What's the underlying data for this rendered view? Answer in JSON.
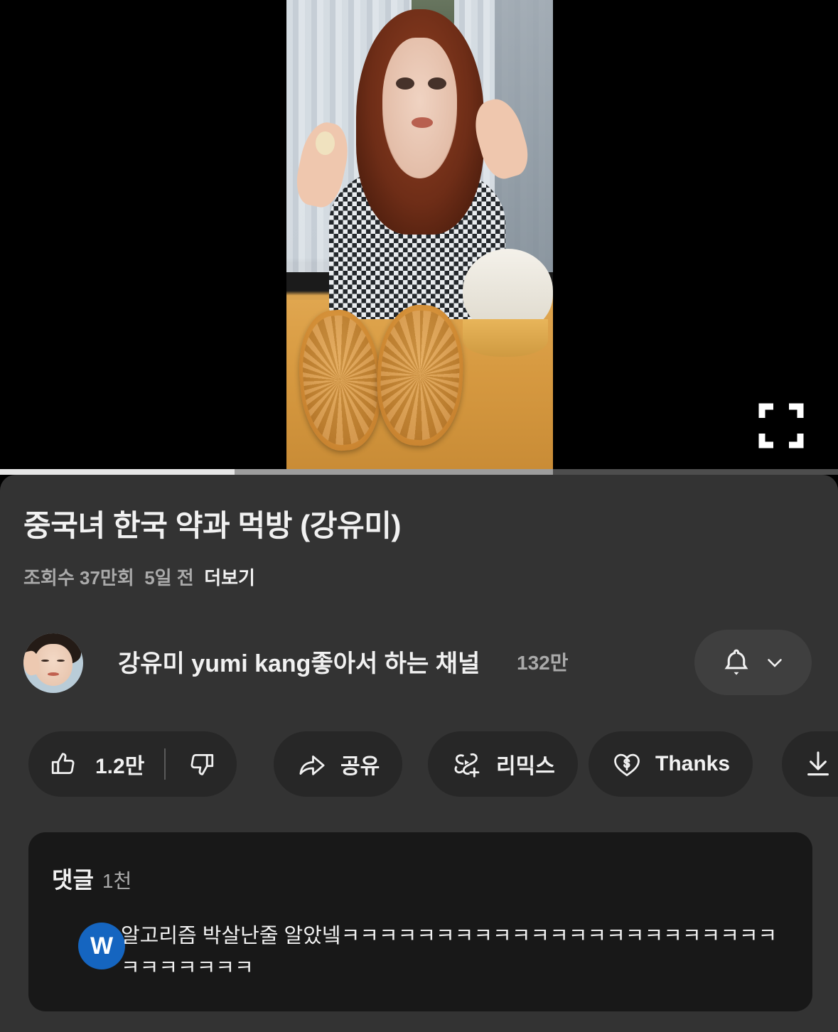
{
  "player": {
    "fullscreen_icon": "fullscreen-icon",
    "progress": {
      "played_percent": 28,
      "buffered_percent": 66
    }
  },
  "video": {
    "title": "중국녀 한국 약과  먹방 (강유미)",
    "views": "조회수 37만회",
    "published": "5일 전",
    "more_label": "더보기"
  },
  "channel": {
    "name": "강유미 yumi kang좋아서 하는 채널",
    "subscribers": "132만",
    "avatar_name": "channel-avatar",
    "bell_icon": "bell-icon",
    "chevron_icon": "chevron-down-icon"
  },
  "actions": {
    "like": {
      "label": "1.2만",
      "icon": "thumbs-up-icon"
    },
    "dislike": {
      "label": "",
      "icon": "thumbs-down-icon"
    },
    "share": {
      "label": "공유",
      "icon": "share-arrow-icon"
    },
    "remix": {
      "label": "리믹스",
      "icon": "remix-icon"
    },
    "thanks": {
      "label": "Thanks",
      "icon": "heart-dollar-icon"
    },
    "download": {
      "label": "",
      "icon": "download-icon"
    }
  },
  "comments": {
    "header": "댓글",
    "count": "1천",
    "top_comment": {
      "avatar_letter": "W",
      "text": "알고리즘 박살난줄 알았넼ㅋㅋㅋㅋㅋㅋㅋㅋㅋㅋㅋㅋㅋㅋㅋㅋㅋㅋㅋㅋㅋㅋㅋㅋㅋㅋㅋㅋㅋㅋ"
    }
  },
  "colors": {
    "page_background": "#000000",
    "info_panel": "#333333",
    "chip": "#272727",
    "bell_chip": "#3f3f3f",
    "comment_card": "#181818",
    "text_primary": "#f1f1f1",
    "text_secondary": "#aaaaaa",
    "comment_avatar": "#1565c0"
  }
}
